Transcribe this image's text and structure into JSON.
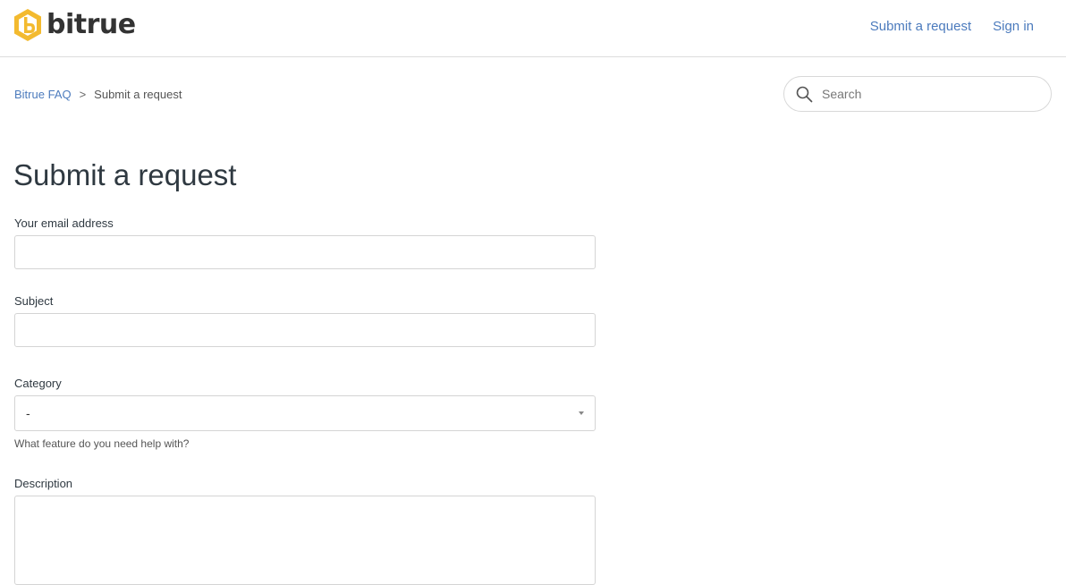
{
  "header": {
    "logo_text": "bitrue",
    "brand_color": "#f3ba2f",
    "nav": {
      "submit_request": "Submit a request",
      "sign_in": "Sign in"
    }
  },
  "breadcrumb": {
    "items": [
      "Bitrue FAQ",
      "Submit a request"
    ],
    "separator": ">"
  },
  "search": {
    "placeholder": "Search",
    "icon": "search-icon"
  },
  "page": {
    "title": "Submit a request"
  },
  "form": {
    "email": {
      "label": "Your email address",
      "value": ""
    },
    "subject": {
      "label": "Subject",
      "value": ""
    },
    "category": {
      "label": "Category",
      "selected": "-",
      "hint": "What feature do you need help with?"
    },
    "description": {
      "label": "Description",
      "value": ""
    }
  },
  "colors": {
    "link": "#4c7bbd",
    "text": "#2f3941",
    "border": "#d4d4d4"
  }
}
